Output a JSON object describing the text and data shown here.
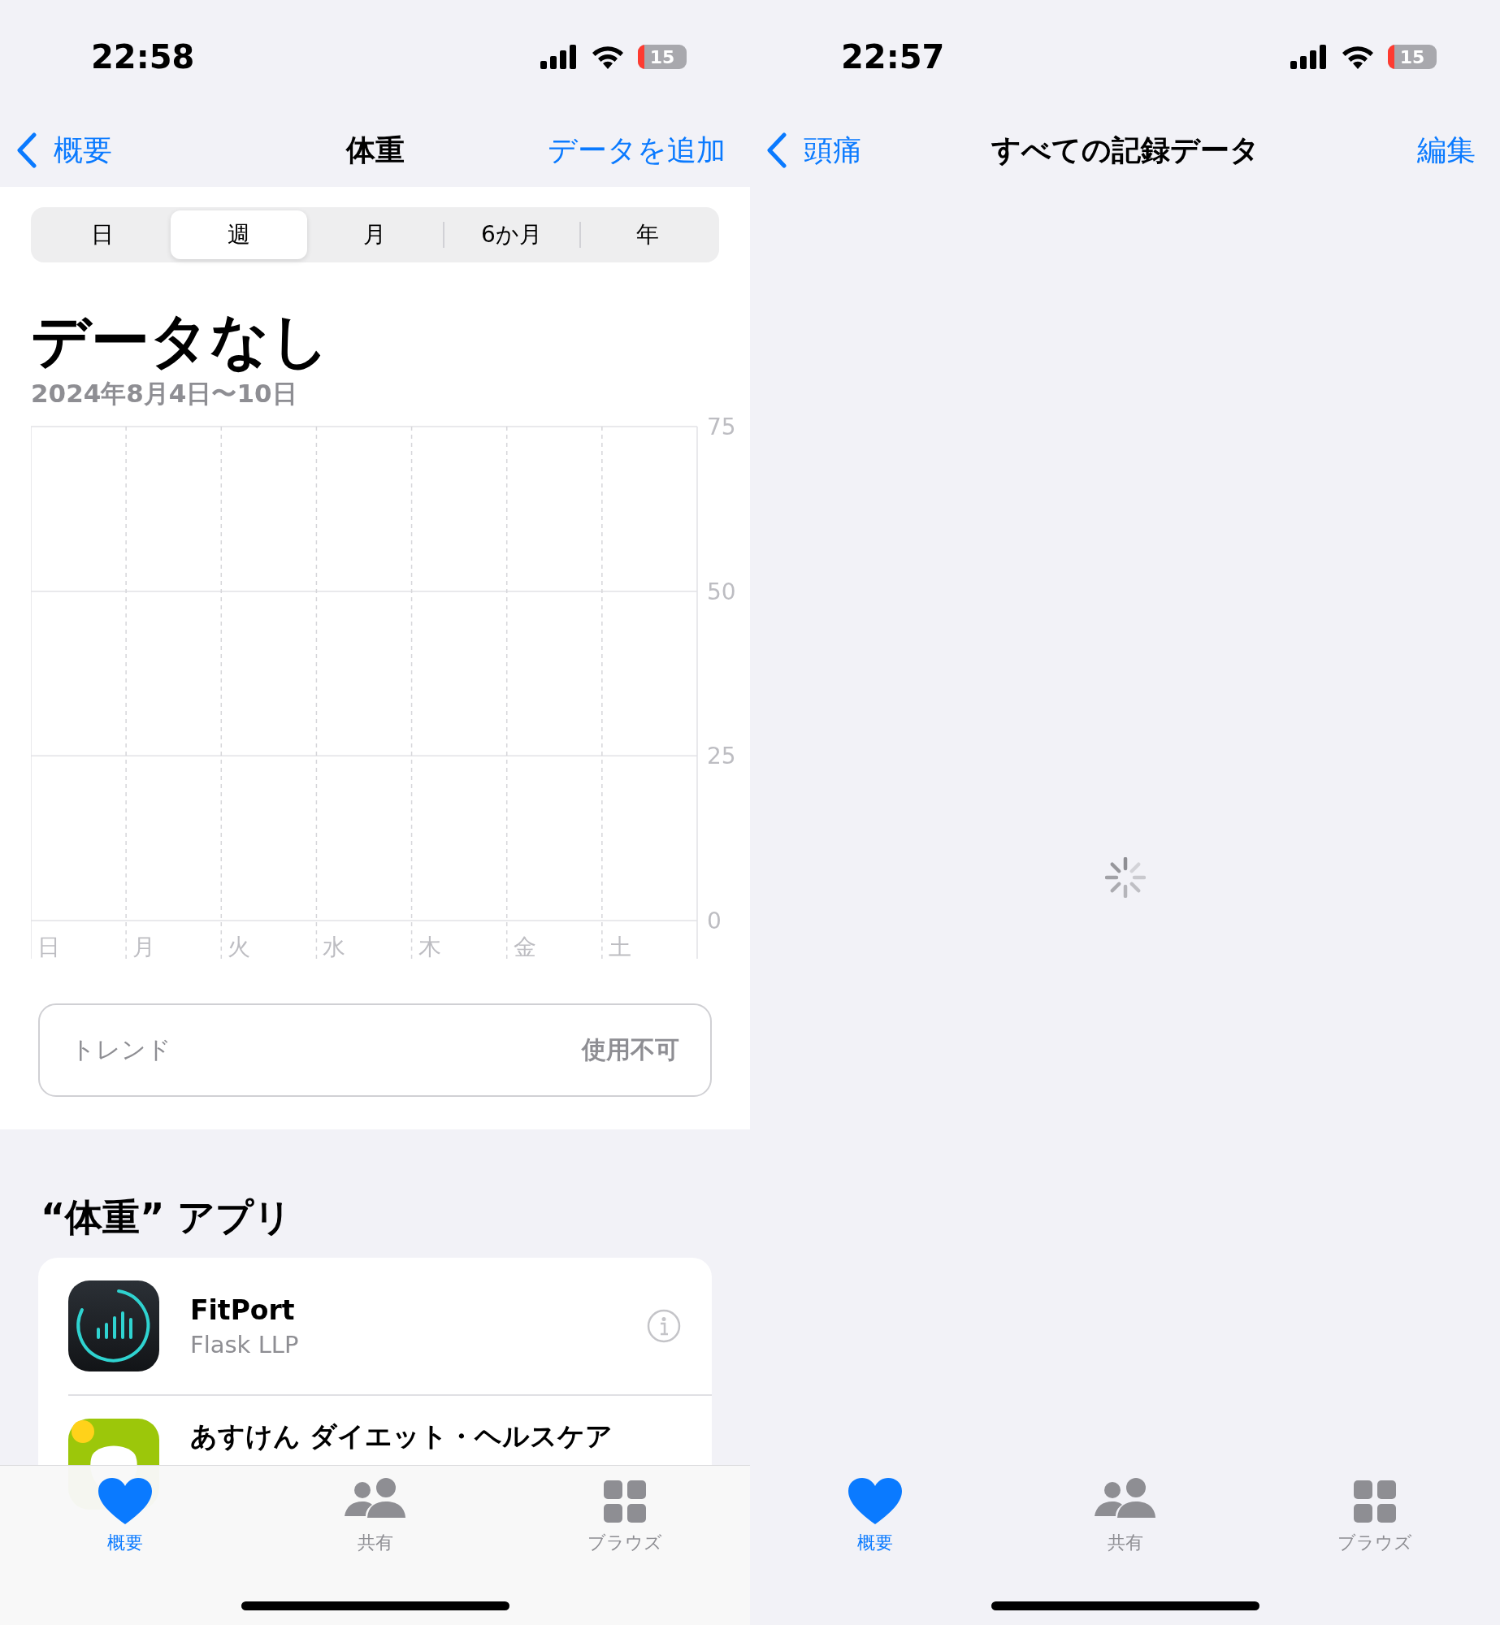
{
  "screens": [
    {
      "kind": "detail",
      "status_bar": {
        "time": "22:58",
        "battery": "15"
      },
      "nav": {
        "back": "概要",
        "title": "体重",
        "action": "データを追加"
      },
      "segments": [
        {
          "label": "日",
          "selected": false
        },
        {
          "label": "週",
          "selected": true
        },
        {
          "label": "月",
          "selected": false
        },
        {
          "label": "6か月",
          "selected": false
        },
        {
          "label": "年",
          "selected": false
        }
      ],
      "headline": "データなし",
      "date_range": "2024年8月4日〜10日",
      "chart_data": {
        "type": "bar",
        "categories": [
          "日",
          "月",
          "火",
          "水",
          "木",
          "金",
          "土"
        ],
        "values": [
          null,
          null,
          null,
          null,
          null,
          null,
          null
        ],
        "ylim": [
          0,
          75
        ],
        "yticks": [
          0,
          25,
          50,
          75
        ]
      },
      "trend": {
        "label": "トレンド",
        "value": "使用不可"
      },
      "apps_section": {
        "title": "“体重” アプリ",
        "apps": [
          {
            "name": "FitPort",
            "developer": "Flask LLP"
          },
          {
            "name": "あすけん ダイエット・ヘルスケア"
          }
        ]
      },
      "tab_bar": [
        {
          "label": "概要",
          "selected": true
        },
        {
          "label": "共有",
          "selected": false
        },
        {
          "label": "ブラウズ",
          "selected": false
        }
      ]
    },
    {
      "kind": "loading",
      "status_bar": {
        "time": "22:57",
        "battery": "15"
      },
      "nav": {
        "back": "頭痛",
        "title": "すべての記録データ",
        "action": "編集"
      },
      "tab_bar": [
        {
          "label": "概要",
          "selected": true
        },
        {
          "label": "共有",
          "selected": false
        },
        {
          "label": "ブラウズ",
          "selected": false
        }
      ]
    }
  ]
}
